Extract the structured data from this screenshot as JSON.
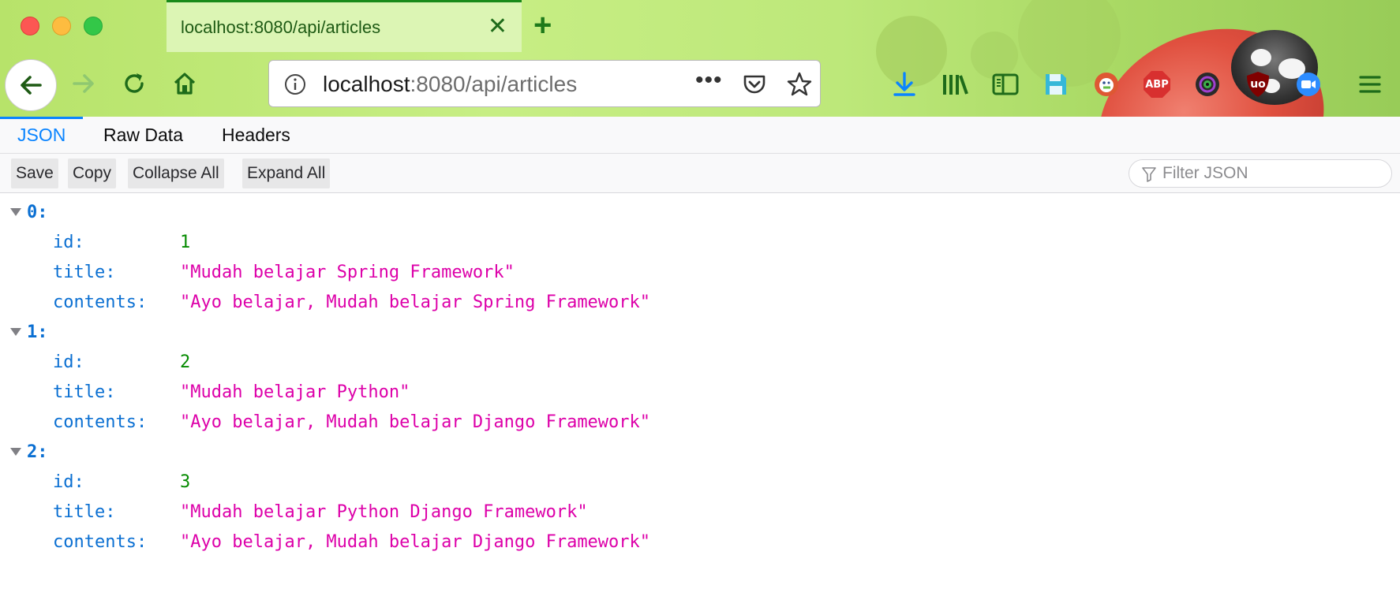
{
  "window": {
    "tab_title": "localhost:8080/api/articles",
    "new_tab_icon": "plus-icon"
  },
  "address_bar": {
    "host": "localhost",
    "rest": ":8080/api/articles"
  },
  "toolbar_icons": {
    "abp_label": "ABP",
    "ublock_label": "uo"
  },
  "viewer": {
    "tabs": [
      "JSON",
      "Raw Data",
      "Headers"
    ],
    "actions": {
      "save": "Save",
      "copy": "Copy",
      "collapse_all": "Collapse All",
      "expand_all": "Expand All"
    },
    "filter_placeholder": "Filter JSON"
  },
  "json": [
    {
      "index": "0:",
      "id_key": "id:",
      "id": "1",
      "title_key": "title:",
      "title": "\"Mudah belajar Spring Framework\"",
      "contents_key": "contents:",
      "contents": "\"Ayo belajar, Mudah belajar Spring Framework\""
    },
    {
      "index": "1:",
      "id_key": "id:",
      "id": "2",
      "title_key": "title:",
      "title": "\"Mudah belajar Python\"",
      "contents_key": "contents:",
      "contents": "\"Ayo belajar, Mudah belajar Django Framework\""
    },
    {
      "index": "2:",
      "id_key": "id:",
      "id": "3",
      "title_key": "title:",
      "title": "\"Mudah belajar Python Django Framework\"",
      "contents_key": "contents:",
      "contents": "\"Ayo belajar, Mudah belajar Django Framework\""
    }
  ],
  "colors": {
    "key": "#0a6fd2",
    "number": "#058b00",
    "string": "#dd00a9",
    "active_tab": "#0a84ff",
    "chrome_green": "#1e7a1a"
  }
}
